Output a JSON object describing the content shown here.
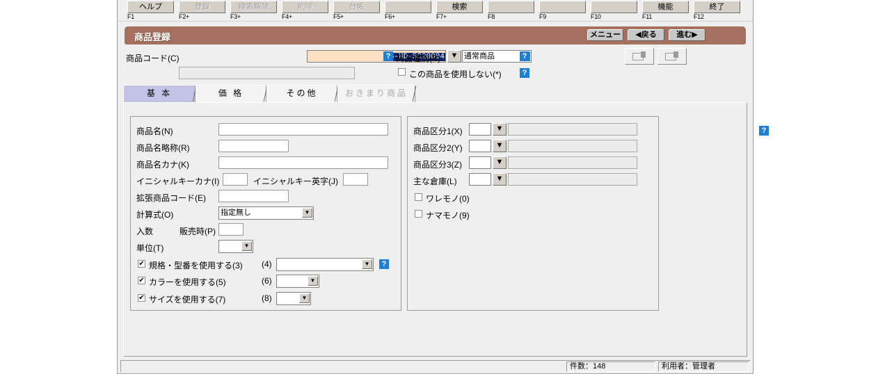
{
  "window": {
    "title": "商品登録",
    "nav_buttons": [
      {
        "name": "menu",
        "label": "メニュー"
      },
      {
        "name": "back",
        "label": "◀戻る"
      },
      {
        "name": "forward",
        "label": "進む▶"
      }
    ]
  },
  "function_keys": [
    {
      "key": "F1",
      "label": "ヘルプ",
      "enabled": true
    },
    {
      "key": "F2+",
      "label": "登録",
      "enabled": false
    },
    {
      "key": "F3+",
      "label": "検索解除",
      "enabled": false
    },
    {
      "key": "F4+",
      "label": "削除",
      "enabled": false
    },
    {
      "key": "F5+",
      "label": "台帳",
      "enabled": false
    },
    {
      "key": "F6+",
      "label": "",
      "enabled": false
    },
    {
      "key": "F7+",
      "label": "検索",
      "enabled": true
    },
    {
      "key": "F8",
      "label": "",
      "enabled": false
    },
    {
      "key": "F9",
      "label": "",
      "enabled": false
    },
    {
      "key": "F10",
      "label": "",
      "enabled": false
    },
    {
      "key": "F11",
      "label": "機能",
      "enabled": true
    },
    {
      "key": "F12",
      "label": "終了",
      "enabled": true
    }
  ],
  "code_row": {
    "label": "商品コード(C)",
    "value": "LG-HD-SC20004",
    "sub_value": "",
    "picker_label": "▼",
    "prev_label": "◀",
    "next_label": "▶",
    "last_label": "▶▶",
    "help_label": "?",
    "type_label": "商品種別(B)",
    "type_value": "通常商品",
    "type_options": [
      "通常商品"
    ],
    "type_help_label": "?",
    "disable_checkbox_label": "この商品を使用しない(*)",
    "disable_checkbox_checked": false,
    "disable_help_label": "?"
  },
  "tabs": [
    {
      "label": "基 本",
      "active": true,
      "enabled": true
    },
    {
      "label": "価 格",
      "active": false,
      "enabled": true
    },
    {
      "label": "その他",
      "active": false,
      "enabled": true
    },
    {
      "label": "おきまり商品",
      "active": false,
      "enabled": false
    }
  ],
  "left_panel": {
    "fields": [
      {
        "label": "商品名(N)",
        "value": ""
      },
      {
        "label": "商品名略称(R)",
        "value": ""
      },
      {
        "label": "商品名カナ(K)",
        "value": ""
      },
      {
        "label": "イニシャルキーカナ(I)",
        "value": ""
      },
      {
        "label": "イニシャルキー英字(J)",
        "value": ""
      },
      {
        "label": "拡張商品コード(E)",
        "value": ""
      }
    ],
    "formula_label": "計算式(O)",
    "formula_value": "指定無し",
    "quantity_label": "入数",
    "quantity_sale_label": "販売時(P)",
    "quantity_sale_value": "",
    "unit_label": "単位(T)",
    "unit_value": "",
    "options": [
      {
        "label": "規格・型番を使用する(3)",
        "checked": true,
        "num": "(4)",
        "value": "",
        "help": "?",
        "wide": true
      },
      {
        "label": "カラーを使用する(5)",
        "checked": true,
        "num": "(6)",
        "value": "",
        "help": "",
        "wide": false
      },
      {
        "label": "サイズを使用する(7)",
        "checked": true,
        "num": "(8)",
        "value": "",
        "help": "",
        "wide": false
      }
    ]
  },
  "right_panel": {
    "lookups": [
      {
        "label": "商品区分1(X)",
        "code": "",
        "display": "",
        "picker": "▼",
        "help": "?"
      },
      {
        "label": "商品区分2(Y)",
        "code": "",
        "display": "",
        "picker": "▼",
        "help": ""
      },
      {
        "label": "商品区分3(Z)",
        "code": "",
        "display": "",
        "picker": "▼",
        "help": ""
      },
      {
        "label": "主な倉庫(L)",
        "code": "",
        "display": "",
        "picker": "▼",
        "help": ""
      }
    ],
    "checkboxes": [
      {
        "label": "ワレモノ(0)",
        "checked": false
      },
      {
        "label": "ナマモノ(9)",
        "checked": false
      }
    ]
  },
  "status_bar": {
    "count": "件数：148",
    "user": "利用者：管理者"
  },
  "colors": {
    "title_bar": "#a5705d",
    "active_tab": "#c3c3e8",
    "code_field": "#ffe2c6",
    "selection": "#0a246a",
    "help_icon": "#1e7fd4",
    "nav_arrow": "#e00000"
  }
}
